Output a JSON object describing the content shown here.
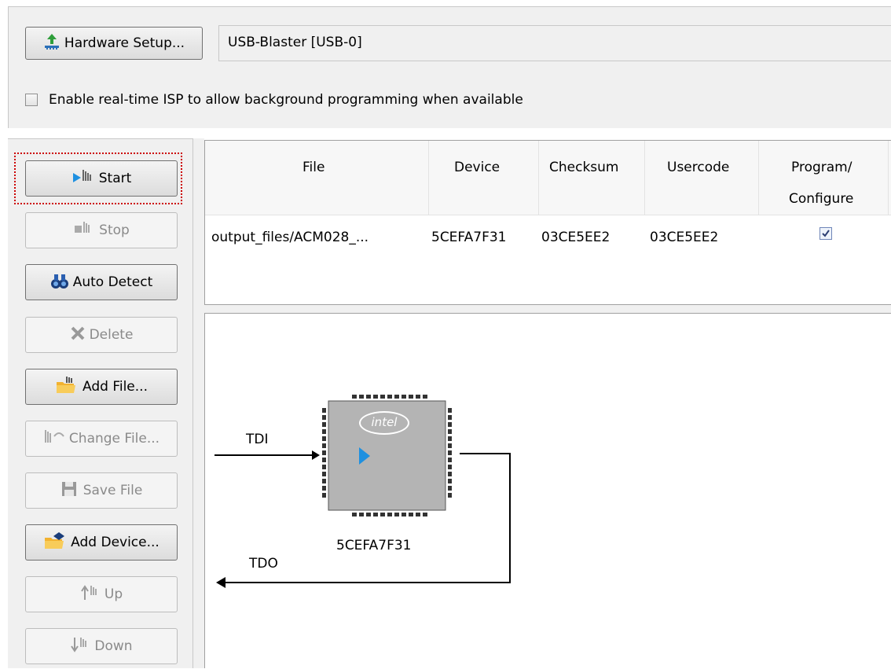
{
  "hardware": {
    "setup_button_label": "Hardware Setup...",
    "selected_hardware": "USB-Blaster [USB-0]"
  },
  "isp": {
    "label": "Enable real-time ISP to allow background programming when available",
    "checked": false
  },
  "side_buttons": {
    "start": "Start",
    "stop": "Stop",
    "auto_detect": "Auto Detect",
    "delete": "Delete",
    "add_file": "Add File...",
    "change_file": "Change File...",
    "save_file": "Save File",
    "add_device": "Add Device...",
    "up": "Up",
    "down": "Down"
  },
  "table": {
    "headers": {
      "file": "File",
      "device": "Device",
      "checksum": "Checksum",
      "usercode": "Usercode",
      "program_line1": "Program/",
      "program_line2": "Configure"
    },
    "rows": [
      {
        "file": "output_files/ACM028_...",
        "device": "5CEFA7F31",
        "checksum": "03CE5EE2",
        "usercode": "03CE5EE2",
        "program_configure": true
      }
    ]
  },
  "diagram": {
    "tdi_label": "TDI",
    "tdo_label": "TDO",
    "chip_device": "5CEFA7F31",
    "chip_logo": "intel"
  },
  "colors": {
    "start_highlight": "#cc0000",
    "play_arrow": "#1e90e0"
  }
}
